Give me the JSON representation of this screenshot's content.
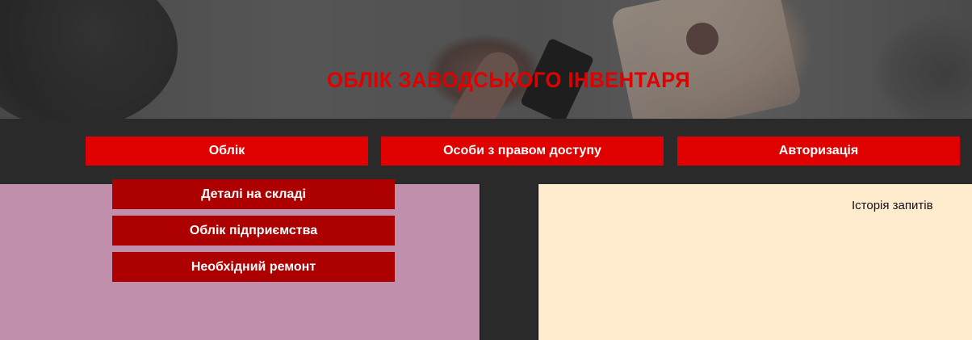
{
  "header": {
    "title": "ОБЛІК ЗАВОДСЬКОГО ІНВЕНТАРЯ"
  },
  "nav": {
    "items": [
      {
        "label": "Облік"
      },
      {
        "label": "Особи з правом доступу"
      },
      {
        "label": "Авторизація"
      }
    ]
  },
  "dropdown": {
    "items": [
      {
        "label": "Деталі на складі"
      },
      {
        "label": "Облік підприємства"
      },
      {
        "label": "Необхідний ремонт"
      }
    ]
  },
  "history_panel": {
    "label": "Історія запитів"
  },
  "colors": {
    "accent": "#e00000",
    "dropdown": "#ad0000",
    "background": "#2a2a2a",
    "left_panel": "#bf8fab",
    "right_panel": "#ffebcd"
  }
}
